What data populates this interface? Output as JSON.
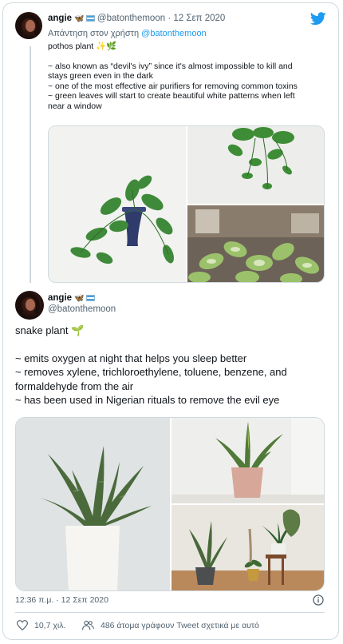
{
  "tweet1": {
    "display_name": "angie",
    "name_emoji": "🦋",
    "handle": "@batonthemoon",
    "separator": "·",
    "date": "12 Σεπ 2020",
    "reply_prefix": "Απάντηση στον χρήστη",
    "reply_handle": "@batonthemoon",
    "lines": [
      "pothos plant ✨🌿",
      "",
      "~ also known as “devil's ivy” since it's almost impossible to kill and",
      "stays green even in the dark",
      "~ one of the most effective air purifiers for removing common toxins",
      "~ green leaves will start to create beautiful white patterns when left",
      "near a window"
    ]
  },
  "tweet2": {
    "display_name": "angie",
    "name_emoji": "🦋",
    "handle": "@batonthemoon",
    "lines": [
      "snake plant 🌱",
      "",
      "~ emits oxygen at night that helps you sleep better",
      "~ removes xylene, trichloroethylene, toluene, benzene, and",
      "formaldehyde from the air",
      "~ has been used in Nigerian rituals to remove the evil eye"
    ],
    "timestamp": "12:36 π.μ. · 12 Σεπ 2020"
  },
  "footer": {
    "likes": "10,7 χιλ.",
    "people_tweeting": "486 άτομα γράφουν Tweet σχετικά με αυτό"
  },
  "icons": {
    "brand": "twitter-bird-icon",
    "info": "info-icon",
    "like": "heart-icon",
    "people": "people-icon"
  },
  "colors": {
    "twitter_blue": "#1d9bf0",
    "text": "#0f1419",
    "muted": "#536471",
    "border": "#cfd9de"
  }
}
